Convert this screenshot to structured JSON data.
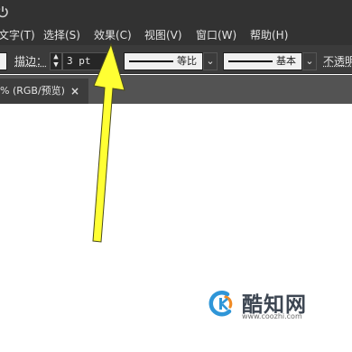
{
  "menubar": {
    "items": [
      {
        "label": "文字(T)"
      },
      {
        "label": "选择(S)"
      },
      {
        "label": "效果(C)"
      },
      {
        "label": "视图(V)"
      },
      {
        "label": "窗口(W)"
      },
      {
        "label": "帮助(H)"
      }
    ]
  },
  "controlbar": {
    "stroke_label": "描边：",
    "stroke_value": "3 pt",
    "profile_label": "等比",
    "brush_label": "基本",
    "opacity_label": "不透明"
  },
  "document_tab": {
    "title": "% (RGB/预览)",
    "close": "×"
  },
  "watermark": {
    "name": "酷知网",
    "url": "www.coozhi.com"
  },
  "colors": {
    "menubar_bg": "#323232",
    "controlbar_bg": "#3b3b3b",
    "arrow": "#ffff33"
  }
}
